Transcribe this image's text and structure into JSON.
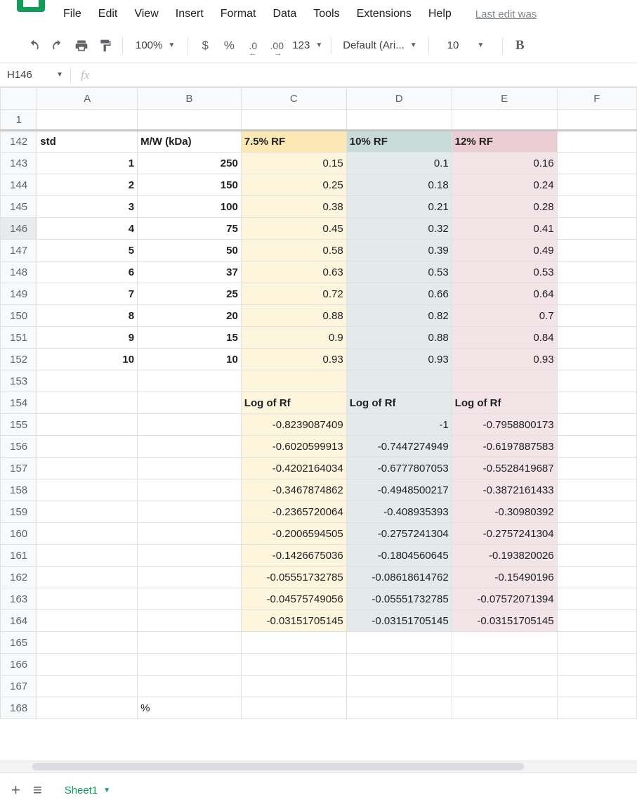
{
  "menu": {
    "file": "File",
    "edit": "Edit",
    "view": "View",
    "insert": "Insert",
    "format": "Format",
    "data": "Data",
    "tools": "Tools",
    "extensions": "Extensions",
    "help": "Help"
  },
  "lastEdit": "Last edit was",
  "toolbar": {
    "zoom": "100%",
    "currency": "$",
    "percent": "%",
    "decLess": ".0",
    "decMore": ".00",
    "numfmt": "123",
    "font": "Default (Ari...",
    "size": "10",
    "bold": "B"
  },
  "namebox": "H146",
  "formula": "",
  "columns": [
    "A",
    "B",
    "C",
    "D",
    "E",
    "F"
  ],
  "frozenRow": "1",
  "selectedRow": "146",
  "rowNumbers": [
    "142",
    "143",
    "144",
    "145",
    "146",
    "147",
    "148",
    "149",
    "150",
    "151",
    "152",
    "153",
    "154",
    "155",
    "156",
    "157",
    "158",
    "159",
    "160",
    "161",
    "162",
    "163",
    "164",
    "165",
    "166",
    "167",
    "168"
  ],
  "rows": [
    {
      "r": "142",
      "A": "std",
      "B": "M/W (kDa)",
      "C": "7.5% RF",
      "D": "10% RF",
      "E": "12% RF",
      "style": "header"
    },
    {
      "r": "143",
      "A": "1",
      "B": "250",
      "C": "0.15",
      "D": "0.1",
      "E": "0.16",
      "style": "data"
    },
    {
      "r": "144",
      "A": "2",
      "B": "150",
      "C": "0.25",
      "D": "0.18",
      "E": "0.24",
      "style": "data"
    },
    {
      "r": "145",
      "A": "3",
      "B": "100",
      "C": "0.38",
      "D": "0.21",
      "E": "0.28",
      "style": "data"
    },
    {
      "r": "146",
      "A": "4",
      "B": "75",
      "C": "0.45",
      "D": "0.32",
      "E": "0.41",
      "style": "data"
    },
    {
      "r": "147",
      "A": "5",
      "B": "50",
      "C": "0.58",
      "D": "0.39",
      "E": "0.49",
      "style": "data"
    },
    {
      "r": "148",
      "A": "6",
      "B": "37",
      "C": "0.63",
      "D": "0.53",
      "E": "0.53",
      "style": "data"
    },
    {
      "r": "149",
      "A": "7",
      "B": "25",
      "C": "0.72",
      "D": "0.66",
      "E": "0.64",
      "style": "data"
    },
    {
      "r": "150",
      "A": "8",
      "B": "20",
      "C": "0.88",
      "D": "0.82",
      "E": "0.7",
      "style": "data"
    },
    {
      "r": "151",
      "A": "9",
      "B": "15",
      "C": "0.9",
      "D": "0.88",
      "E": "0.84",
      "style": "data"
    },
    {
      "r": "152",
      "A": "10",
      "B": "10",
      "C": "0.93",
      "D": "0.93",
      "E": "0.93",
      "style": "data"
    },
    {
      "r": "153",
      "A": "",
      "B": "",
      "C": "",
      "D": "",
      "E": "",
      "style": "colored-empty"
    },
    {
      "r": "154",
      "A": "",
      "B": "",
      "C": "Log of Rf",
      "D": "Log of Rf",
      "E": "Log of Rf",
      "style": "subheader"
    },
    {
      "r": "155",
      "A": "",
      "B": "",
      "C": "-0.8239087409",
      "D": "-1",
      "E": "-0.7958800173",
      "style": "log"
    },
    {
      "r": "156",
      "A": "",
      "B": "",
      "C": "-0.6020599913",
      "D": "-0.7447274949",
      "E": "-0.6197887583",
      "style": "log"
    },
    {
      "r": "157",
      "A": "",
      "B": "",
      "C": "-0.4202164034",
      "D": "-0.6777807053",
      "E": "-0.5528419687",
      "style": "log"
    },
    {
      "r": "158",
      "A": "",
      "B": "",
      "C": "-0.3467874862",
      "D": "-0.4948500217",
      "E": "-0.3872161433",
      "style": "log"
    },
    {
      "r": "159",
      "A": "",
      "B": "",
      "C": "-0.2365720064",
      "D": "-0.408935393",
      "E": "-0.30980392",
      "style": "log"
    },
    {
      "r": "160",
      "A": "",
      "B": "",
      "C": "-0.2006594505",
      "D": "-0.2757241304",
      "E": "-0.2757241304",
      "style": "log"
    },
    {
      "r": "161",
      "A": "",
      "B": "",
      "C": "-0.1426675036",
      "D": "-0.1804560645",
      "E": "-0.193820026",
      "style": "log"
    },
    {
      "r": "162",
      "A": "",
      "B": "",
      "C": "-0.05551732785",
      "D": "-0.08618614762",
      "E": "-0.15490196",
      "style": "log"
    },
    {
      "r": "163",
      "A": "",
      "B": "",
      "C": "-0.04575749056",
      "D": "-0.05551732785",
      "E": "-0.07572071394",
      "style": "log"
    },
    {
      "r": "164",
      "A": "",
      "B": "",
      "C": "-0.03151705145",
      "D": "-0.03151705145",
      "E": "-0.03151705145",
      "style": "log"
    },
    {
      "r": "165",
      "A": "",
      "B": "",
      "C": "",
      "D": "",
      "E": "",
      "style": "plain"
    },
    {
      "r": "166",
      "A": "",
      "B": "",
      "C": "",
      "D": "",
      "E": "",
      "style": "plain"
    },
    {
      "r": "167",
      "A": "",
      "B": "",
      "C": "",
      "D": "",
      "E": "",
      "style": "plain"
    },
    {
      "r": "168",
      "A": "",
      "B": "%",
      "C": "",
      "D": "",
      "E": "",
      "style": "plain-left"
    }
  ],
  "sheetTab": "Sheet1",
  "colors": {
    "yellow": "#fce8b2",
    "yellowL": "#fef5dd",
    "blue": "#c9dbd9",
    "blueL": "#e2ebea",
    "pink": "#ebcdd4",
    "pinkL": "#f3e4e8"
  }
}
